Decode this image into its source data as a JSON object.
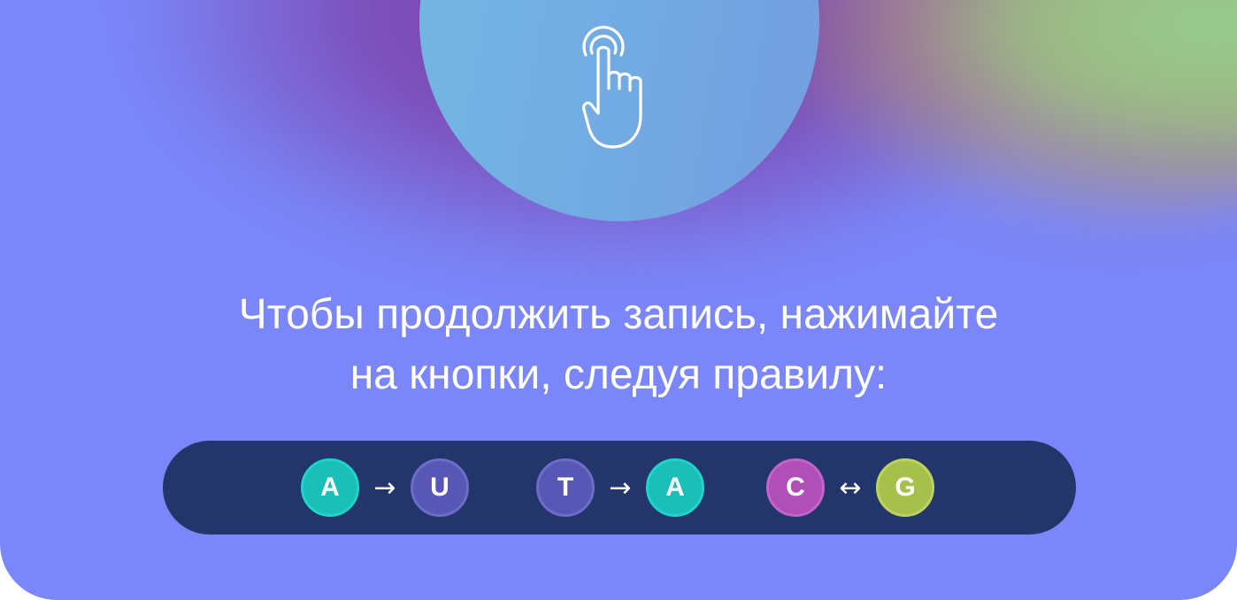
{
  "hint": {
    "icon": "tap-finger-icon",
    "line1": "Чтобы продолжить запись, нажимайте",
    "line2": "на кнопки, следуя правилу:"
  },
  "rules": [
    {
      "from": "A",
      "arrow": "→",
      "to": "U"
    },
    {
      "from": "T",
      "arrow": "→",
      "to": "A"
    },
    {
      "from": "C",
      "arrow": "↔",
      "to": "G"
    }
  ],
  "colors": {
    "background": "#7b86f8",
    "bar": "#22366c",
    "A": "#1bbfb8",
    "U": "#5857b5",
    "T": "#5857b5",
    "C": "#b14fb8",
    "G": "#a7c04b"
  }
}
